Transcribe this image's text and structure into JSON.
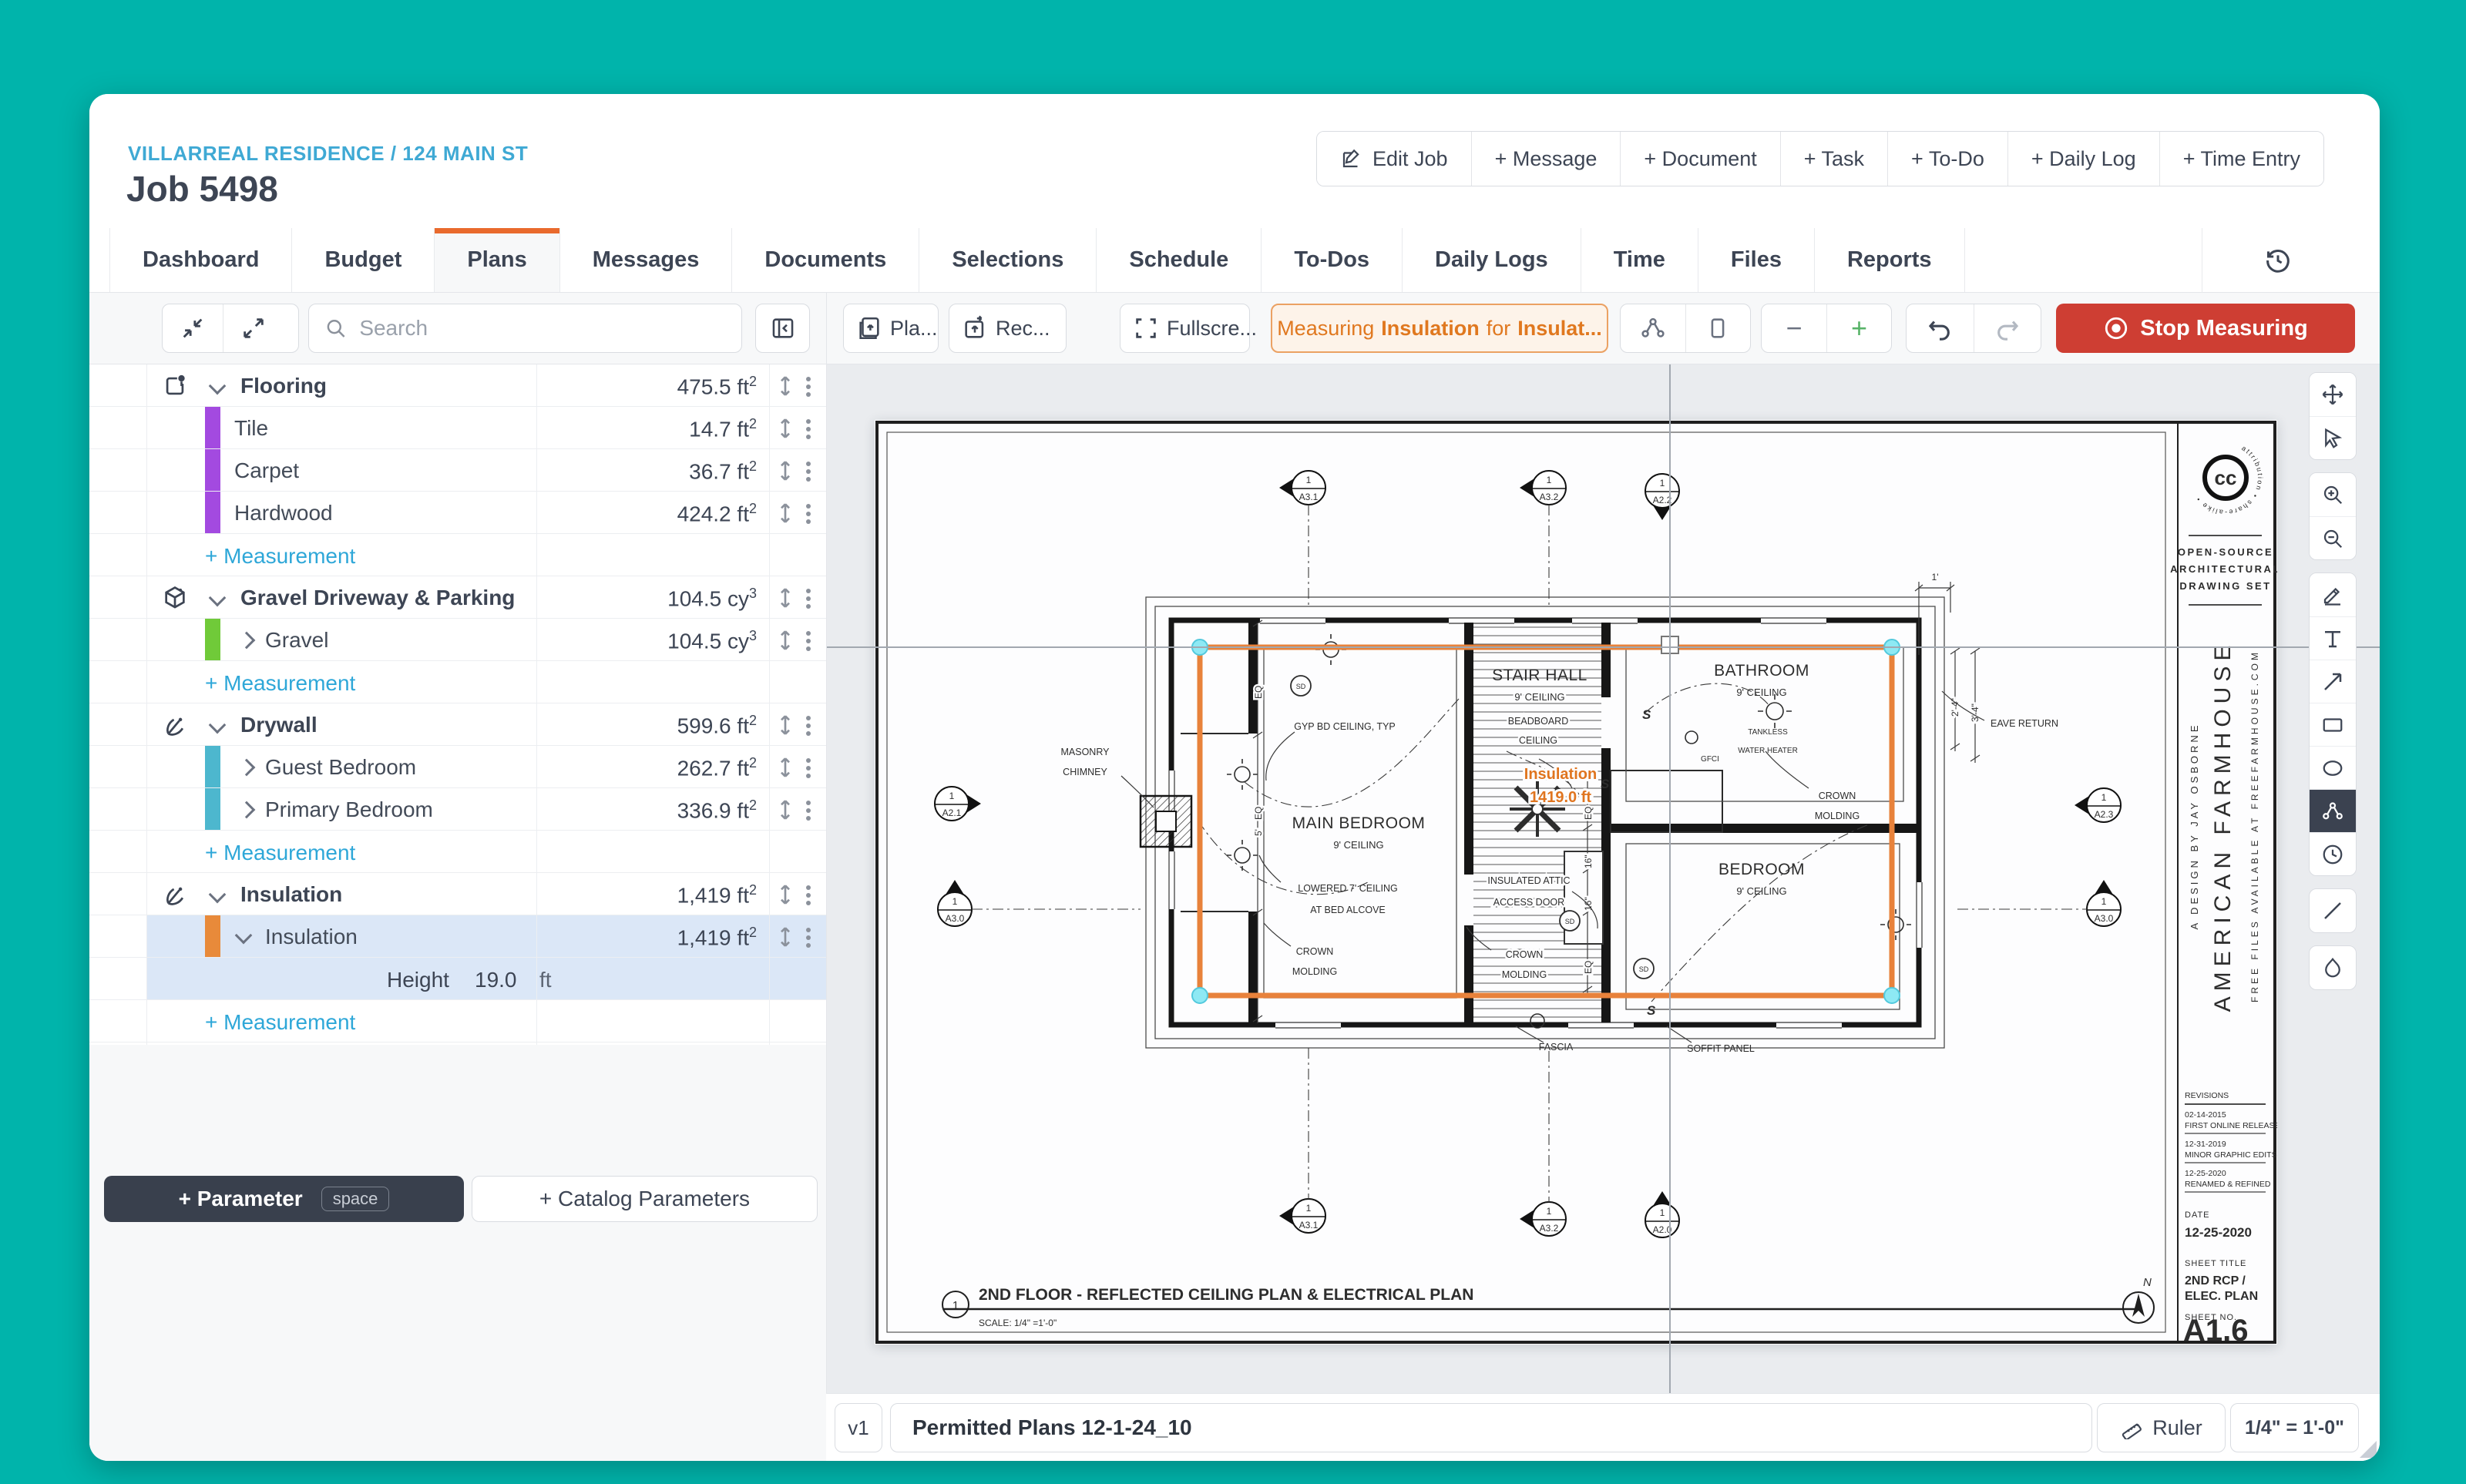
{
  "colors": {
    "frame_teal": "#00b4ab",
    "link_blue": "#3fa9d4",
    "tab_accent": "#e96a2d",
    "measure_orange": "#e0781f",
    "stop_red": "#ce3e33",
    "selection_blue": "#dbe7f7",
    "bar_purple": "#a34ae0",
    "bar_green": "#70ca39",
    "bar_teal": "#4db7ce",
    "bar_orange": "#e88a3a",
    "add_blue": "#2ea7d8"
  },
  "header": {
    "breadcrumb": "VILLARREAL RESIDENCE / 124 MAIN ST",
    "job_title": "Job 5498",
    "actions": [
      "Edit Job",
      "+ Message",
      "+ Document",
      "+ Task",
      "+ To-Do",
      "+ Daily Log",
      "+ Time Entry"
    ]
  },
  "tabs": {
    "active": "Plans",
    "items": [
      {
        "label": "Dashboard"
      },
      {
        "label": "Budget"
      },
      {
        "label": "Plans"
      },
      {
        "label": "Messages"
      },
      {
        "label": "Documents"
      },
      {
        "label": "Selections"
      },
      {
        "label": "Schedule"
      },
      {
        "label": "To-Dos"
      },
      {
        "label": "Daily Logs"
      },
      {
        "label": "Time"
      },
      {
        "label": "Files"
      },
      {
        "label": "Reports"
      }
    ]
  },
  "panel_toolbar": {
    "search_placeholder": "Search"
  },
  "canvas_toolbar": {
    "plans_label": "Pla...",
    "recent_label": "Rec...",
    "fullscreen_label": "Fullscre...",
    "measuring": {
      "prefix": "Measuring",
      "subject": "Insulation",
      "middle": "for",
      "target": "Insulat..."
    },
    "stop_label": "Stop Measuring"
  },
  "tree": {
    "rows": [
      {
        "type": "group",
        "label": "Flooring",
        "value": "475.5",
        "unit": "ft",
        "sup": "2"
      },
      {
        "type": "child",
        "label": "Tile",
        "value": "14.7",
        "unit": "ft",
        "sup": "2"
      },
      {
        "type": "child",
        "label": "Carpet",
        "value": "36.7",
        "unit": "ft",
        "sup": "2"
      },
      {
        "type": "child",
        "label": "Hardwood",
        "value": "424.2",
        "unit": "ft",
        "sup": "2"
      },
      {
        "type": "add",
        "label": "+ Measurement"
      },
      {
        "type": "group",
        "label": "Gravel Driveway & Parking",
        "value": "104.5",
        "unit": "cy",
        "sup": "3"
      },
      {
        "type": "child",
        "label": "Gravel",
        "value": "104.5",
        "unit": "cy",
        "sup": "3"
      },
      {
        "type": "add",
        "label": "+ Measurement"
      },
      {
        "type": "group",
        "label": "Drywall",
        "value": "599.6",
        "unit": "ft",
        "sup": "2"
      },
      {
        "type": "child",
        "label": "Guest Bedroom",
        "value": "262.7",
        "unit": "ft",
        "sup": "2"
      },
      {
        "type": "child",
        "label": "Primary Bedroom",
        "value": "336.9",
        "unit": "ft",
        "sup": "2"
      },
      {
        "type": "add",
        "label": "+ Measurement"
      },
      {
        "type": "group",
        "label": "Insulation",
        "value": "1,419",
        "unit": "ft",
        "sup": "2"
      },
      {
        "type": "child",
        "label": "Insulation",
        "value": "1,419",
        "unit": "ft",
        "sup": "2",
        "selected": true
      },
      {
        "type": "param",
        "label": "Height",
        "value": "19.0",
        "unit": "ft",
        "selected": true
      },
      {
        "type": "add",
        "label": "+ Measurement"
      }
    ]
  },
  "parameter_bar": {
    "add_parameter": "+ Parameter",
    "shortcut": "space",
    "add_catalog": "+ Catalog Parameters"
  },
  "right_toolbar": {
    "active": "polyline",
    "tools": [
      "move",
      "select",
      "zoom-in",
      "zoom-out",
      "draw",
      "text",
      "arrow",
      "rectangle",
      "ellipse",
      "polyline",
      "history",
      "line",
      "polygon"
    ]
  },
  "bottom_bar": {
    "version": "v1",
    "filename": "Permitted Plans 12-1-24_10",
    "ruler_label": "Ruler",
    "scale": "1/4\" = 1'-0\""
  },
  "plan": {
    "labels": {
      "gyp": "GYP BD CEILING, TYP",
      "stair_hall": "STAIR HALL",
      "ceiling9": "9' CEILING",
      "beadboard1": "BEADBOARD",
      "beadboard2": "CEILING",
      "bathroom": "BATHROOM",
      "tankless1": "TANKLESS",
      "tankless2": "WATER HEATER",
      "gfci": "GFCI",
      "main_bedroom": "MAIN BEDROOM",
      "bedroom": "BEDROOM",
      "lowered1": "LOWERED 7' CEILING",
      "lowered2": "AT BED ALCOVE",
      "attic1": "INSULATED ATTIC",
      "attic2": "ACCESS DOOR",
      "crown": "CROWN",
      "molding": "MOLDING",
      "masonry1": "MASONRY",
      "masonry2": "CHIMNEY",
      "eave": "EAVE RETURN",
      "fascia": "FASCIA",
      "soffit": "SOFFIT PANEL",
      "sd": "SD",
      "s": "S",
      "north": "N"
    },
    "overlay": {
      "line1": "Insulation",
      "line2": "1419.0 ft"
    },
    "dims": {
      "eq": "EQ",
      "five": "5'",
      "sixteen": "16\"",
      "one_ft": "1'",
      "two_four": "2'-4\"",
      "three_four": "3'-4\""
    },
    "markers": {
      "num": "1",
      "a31": "A3.1",
      "a32": "A3.2",
      "a22": "A2.2",
      "a20": "A2.0",
      "a21": "A2.1",
      "a30": "A3.0",
      "a23": "A2.3"
    },
    "title": {
      "num": "1",
      "text": "2ND FLOOR - REFLECTED CEILING PLAN & ELECTRICAL PLAN",
      "scale": "SCALE: 1/4\" =1'-0\""
    },
    "titleblock": {
      "cc": "cc",
      "ring": "attribution  •  share-alike  •",
      "open1": "OPEN-SOURCE",
      "open2": "ARCHITECTURAL",
      "open3": "DRAWING SET",
      "farmhouse": "AMERICAN FARMHOUSE",
      "design": "A DESIGN BY JAY OSBORNE",
      "free": "FREE FILES AVAILABLE AT FREEFARMHOUSE.COM",
      "revisions_label": "REVISIONS",
      "rev": [
        {
          "d": "02-14-2015",
          "n": "FIRST ONLINE RELEASE"
        },
        {
          "d": "12-31-2019",
          "n": "MINOR GRAPHIC EDITS"
        },
        {
          "d": "12-25-2020",
          "n": "RENAMED & REFINED"
        }
      ],
      "date_label": "DATE",
      "date": "12-25-2020",
      "sheet_title_label": "SHEET TITLE",
      "sheet_title1": "2ND RCP /",
      "sheet_title2": "ELEC. PLAN",
      "sheet_no_label": "SHEET NO.",
      "sheet_no": "A1.6"
    }
  }
}
